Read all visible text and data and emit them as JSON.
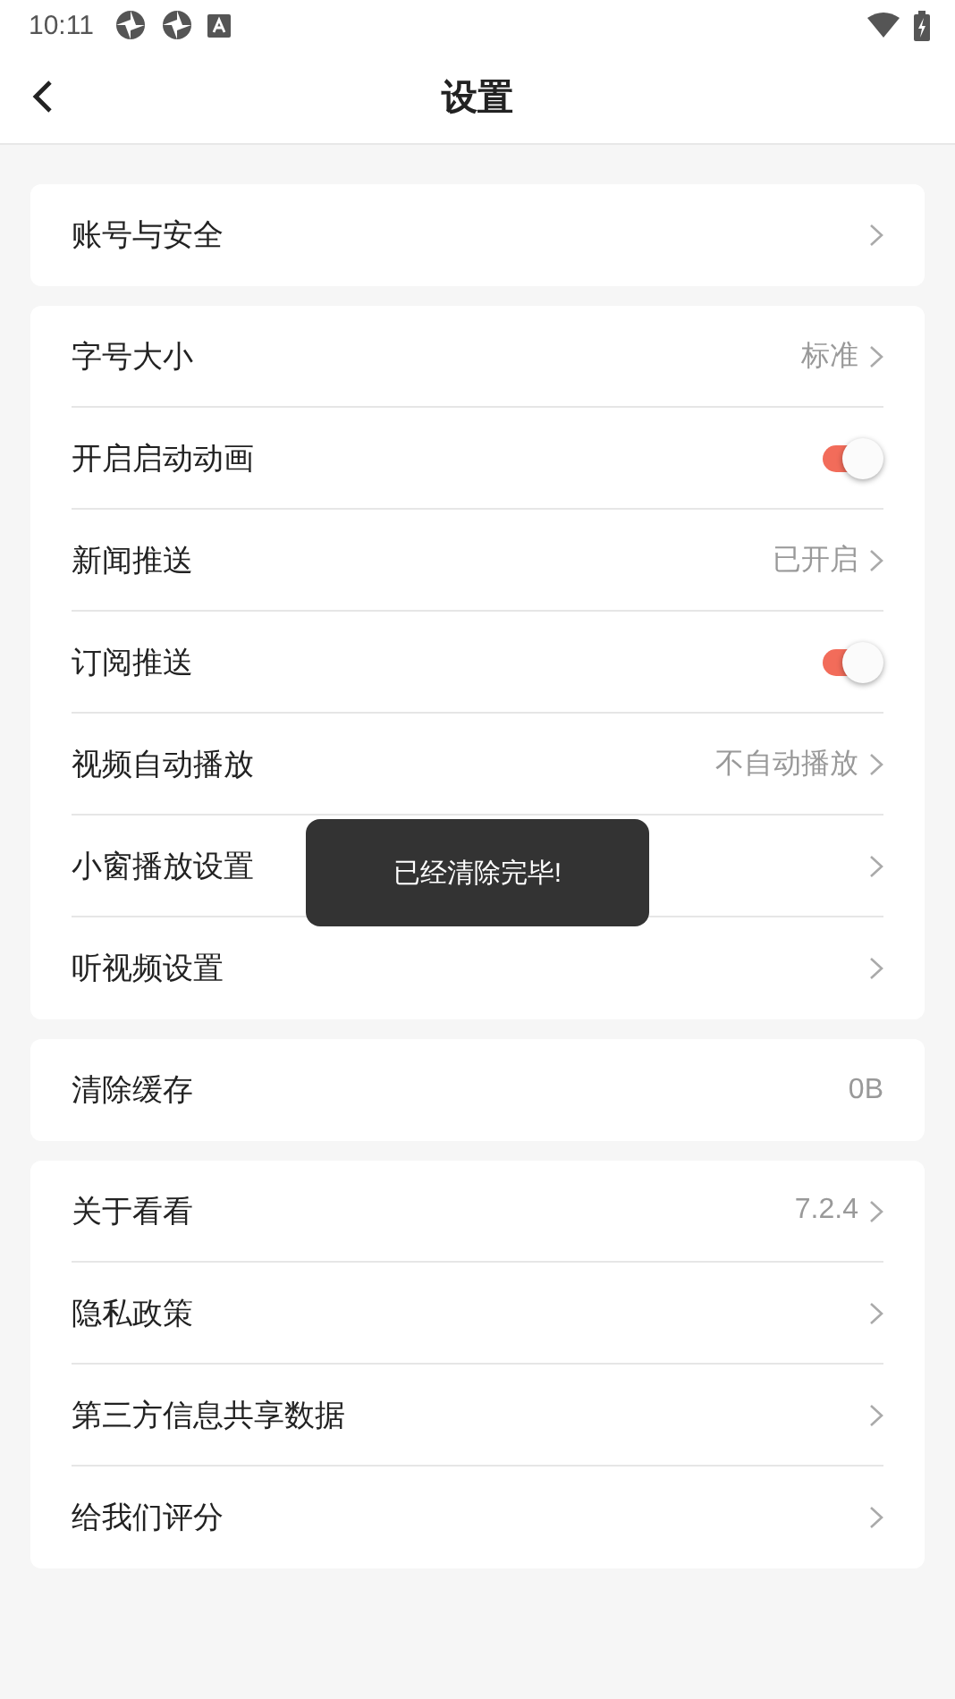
{
  "status_bar": {
    "time": "10:11"
  },
  "header": {
    "title": "设置"
  },
  "groups": [
    {
      "rows": [
        {
          "kind": "link",
          "label": "账号与安全"
        }
      ]
    },
    {
      "rows": [
        {
          "kind": "link",
          "label": "字号大小",
          "value": "标准"
        },
        {
          "kind": "toggle",
          "label": "开启启动动画",
          "on": true
        },
        {
          "kind": "link",
          "label": "新闻推送",
          "value": "已开启"
        },
        {
          "kind": "toggle",
          "label": "订阅推送",
          "on": true
        },
        {
          "kind": "link",
          "label": "视频自动播放",
          "value": "不自动播放"
        },
        {
          "kind": "link",
          "label": "小窗播放设置"
        },
        {
          "kind": "link",
          "label": "听视频设置"
        }
      ]
    },
    {
      "rows": [
        {
          "kind": "value",
          "label": "清除缓存",
          "value": "0B"
        }
      ]
    },
    {
      "rows": [
        {
          "kind": "link",
          "label": "关于看看",
          "value": "7.2.4"
        },
        {
          "kind": "link",
          "label": "隐私政策"
        },
        {
          "kind": "link",
          "label": "第三方信息共享数据"
        },
        {
          "kind": "link",
          "label": "给我们评分"
        }
      ]
    }
  ],
  "toast": {
    "text": "已经清除完毕!"
  }
}
